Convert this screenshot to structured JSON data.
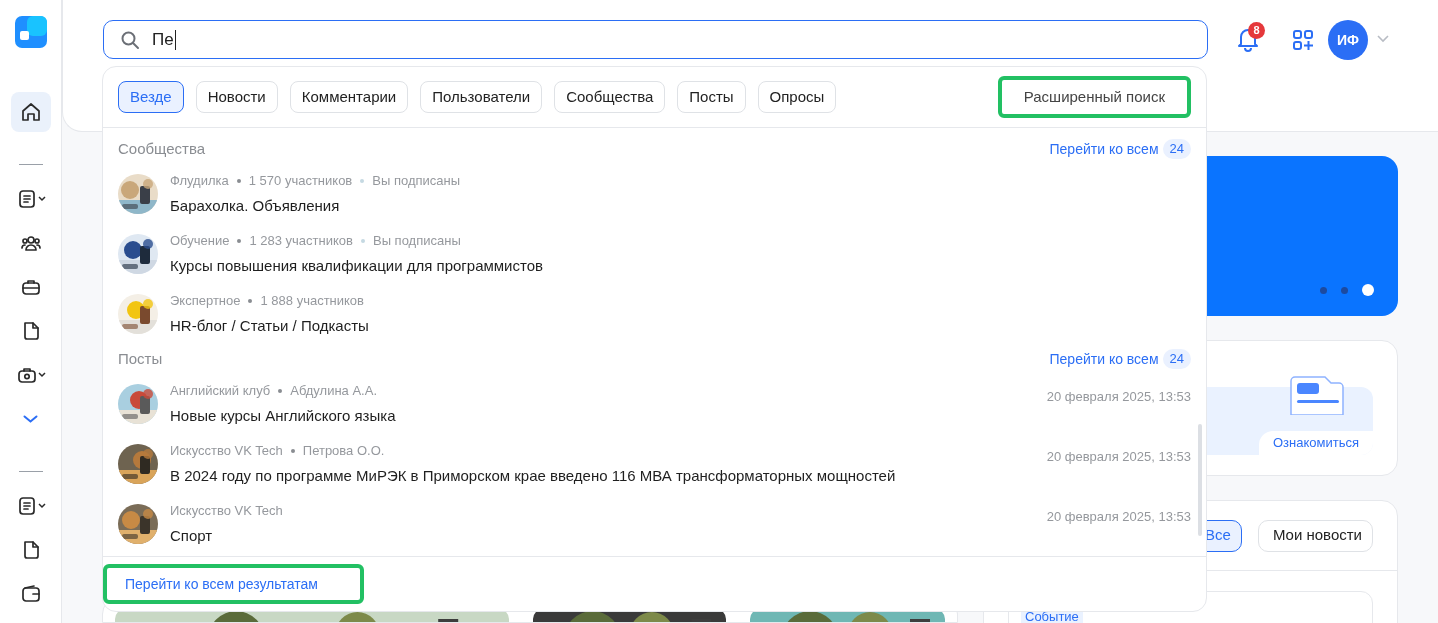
{
  "sidebar": {
    "items": [
      {
        "selected": true,
        "dropdown": false
      },
      {
        "selected": false,
        "dropdown": true
      },
      {
        "selected": false,
        "dropdown": false
      },
      {
        "selected": false,
        "dropdown": false
      },
      {
        "selected": false,
        "dropdown": false
      },
      {
        "selected": false,
        "dropdown": true
      },
      {
        "selected": false,
        "dropdown": false,
        "kind": "more"
      },
      {
        "selected": false,
        "dropdown": true
      },
      {
        "selected": false,
        "dropdown": false
      },
      {
        "selected": false,
        "dropdown": false
      }
    ]
  },
  "header": {
    "search": {
      "value": "Пе"
    },
    "notifications_badge": "8",
    "avatar_initials": "ИФ"
  },
  "search_dropdown": {
    "filters": [
      {
        "label": "Везде",
        "selected": true
      },
      {
        "label": "Новости",
        "selected": false
      },
      {
        "label": "Комментарии",
        "selected": false
      },
      {
        "label": "Пользователи",
        "selected": false
      },
      {
        "label": "Сообщества",
        "selected": false
      },
      {
        "label": "Посты",
        "selected": false
      },
      {
        "label": "Опросы",
        "selected": false
      }
    ],
    "advanced_search": {
      "label": "Расширенный поиск",
      "highlighted": true
    },
    "sections": [
      {
        "title": "Сообщества",
        "link": "Перейти ко всем",
        "count": "24",
        "items": [
          {
            "meta": [
              "Флудилка",
              "1 570 участников"
            ],
            "subscription": "Вы подписаны",
            "title": "Барахолка. Объявления"
          },
          {
            "meta": [
              "Обучение",
              "1 283 участников"
            ],
            "subscription": "Вы подписаны",
            "title": "Курсы повышения квалификации для программистов"
          },
          {
            "meta": [
              "Экспертное",
              "1 888 участников"
            ],
            "title": "HR-блог / Статьи / Подкасты"
          }
        ]
      },
      {
        "title": "Посты",
        "link": "Перейти ко всем",
        "count": "24",
        "items": [
          {
            "meta": [
              "Английский клуб",
              "Абдулина А.А."
            ],
            "title": "Новые курсы Английского языка",
            "date": "20 февраля 2025, 13:53"
          },
          {
            "meta": [
              "Искусство VK Tech",
              "Петрова О.О."
            ],
            "title": "В 2024 году по программе МиРЭК в Приморском крае введено 116 МВА трансформаторных мощностей",
            "date": "20 февраля 2025, 13:53"
          },
          {
            "meta": [
              "Искусство VK Tech"
            ],
            "title": "Спорт",
            "date": "20 февраля 2025, 13:53"
          }
        ]
      }
    ],
    "all_results": {
      "label": "Перейти ко всем результатам",
      "highlighted": true
    }
  },
  "background": {
    "banner_dots": [
      {
        "selected": false
      },
      {
        "selected": false
      },
      {
        "selected": true
      }
    ],
    "promo_button": "Ознакомиться",
    "feed_tabs": [
      {
        "label": "Все",
        "selected": true
      },
      {
        "label": "Мои новости",
        "selected": false
      }
    ],
    "tag": "Событие"
  }
}
